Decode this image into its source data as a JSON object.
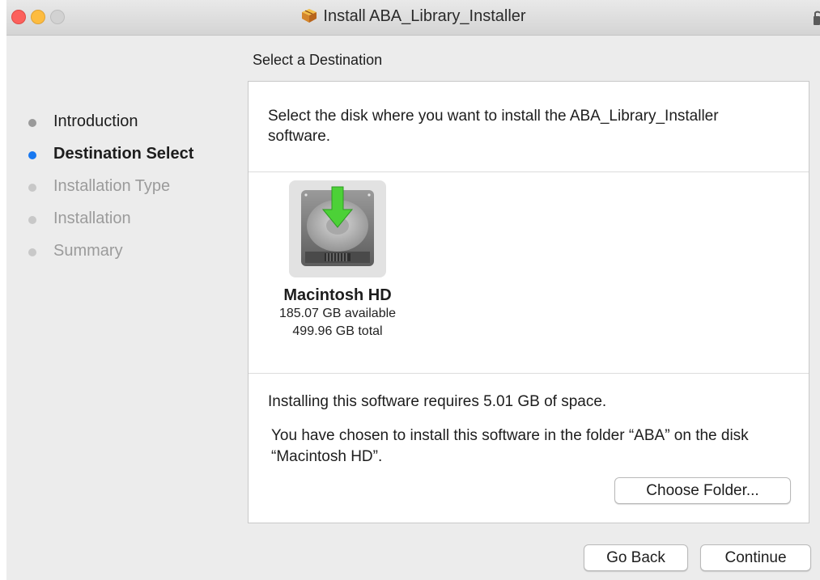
{
  "window": {
    "title": "Install ABA_Library_Installer",
    "icons": {
      "app": "package-icon",
      "lock": "lock-icon"
    }
  },
  "page": {
    "title": "Select a Destination"
  },
  "steps": [
    {
      "label": "Introduction",
      "state": "done"
    },
    {
      "label": "Destination Select",
      "state": "current"
    },
    {
      "label": "Installation Type",
      "state": "pending"
    },
    {
      "label": "Installation",
      "state": "pending"
    },
    {
      "label": "Summary",
      "state": "pending"
    }
  ],
  "panel": {
    "instruction": "Select the disk where you want to install the ABA_Library_Installer software.",
    "disk": {
      "name": "Macintosh HD",
      "available": "185.07 GB available",
      "total": "499.96 GB total",
      "icon": "hard-drive-icon"
    },
    "requirement": "Installing this software requires 5.01 GB of space.",
    "chosen_location": "You have chosen to install this software in the folder “ABA” on the disk “Macintosh HD”.",
    "choose_folder_label": "Choose Folder..."
  },
  "footer": {
    "back_label": "Go Back",
    "continue_label": "Continue"
  },
  "colors": {
    "accent": "#1878f0",
    "download_arrow": "#4cd137",
    "close": "#fc605c",
    "minimize": "#fdbc40"
  }
}
